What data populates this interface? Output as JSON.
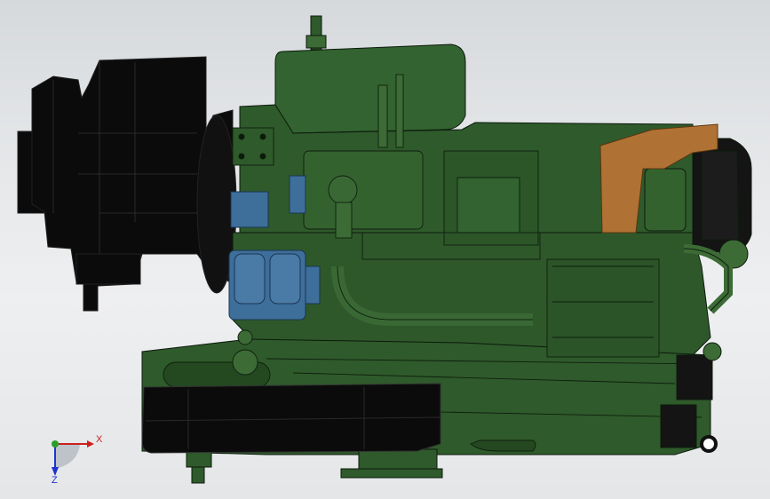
{
  "viewport": {
    "colors": {
      "body_green": "#2f5a2b",
      "body_green_light": "#3c6b36",
      "body_green_dark": "#1e3d1c",
      "outline": "#0c1a0c",
      "blue_part": "#3e6e9a",
      "orange_bracket": "#b07234",
      "black_part": "#0b0b0b"
    }
  },
  "triad": {
    "x_label": "X",
    "z_label": "Z",
    "x_color": "#cc1f1f",
    "z_color": "#1f33cc",
    "origin_color": "#2a9d2a"
  }
}
